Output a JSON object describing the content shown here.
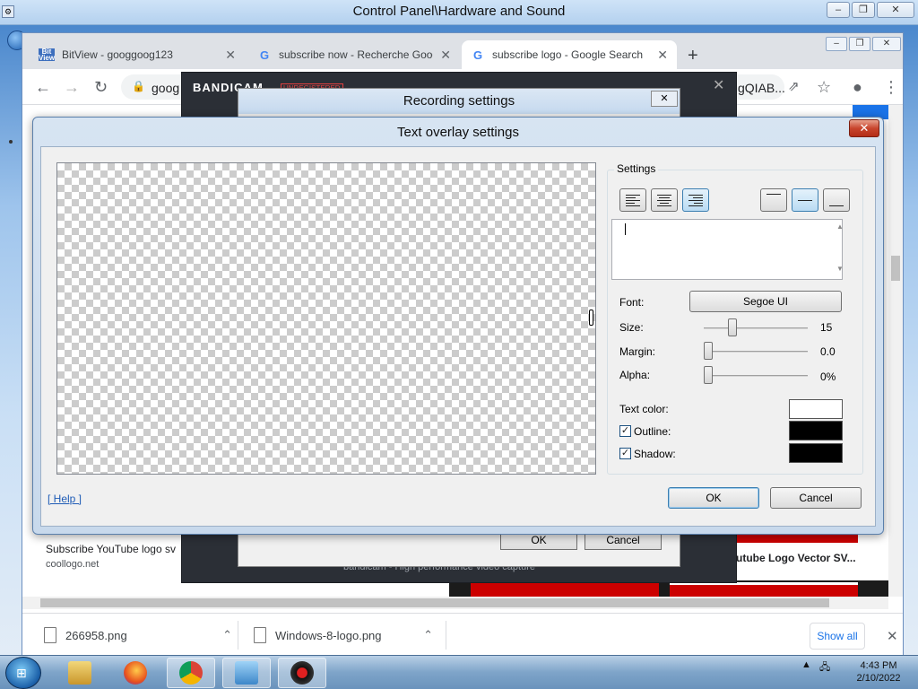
{
  "control_panel": {
    "title": "Control Panel\\Hardware and Sound"
  },
  "chrome": {
    "tabs": [
      {
        "label": "BitView - googgoog123"
      },
      {
        "label": "subscribe now - Recherche Goog"
      },
      {
        "label": "subscribe logo - Google Search"
      }
    ],
    "new_tab": "+",
    "address_text": "goog",
    "address_text_right": "gQIAB...",
    "page": {
      "caption_left": "Subscribe YouTube logo sv",
      "caption_left_source": "coollogo.net",
      "caption_right": "utube Logo Vector SV..."
    },
    "downloads": [
      {
        "name": "266958.png"
      },
      {
        "name": "Windows-8-logo.png"
      }
    ],
    "show_all": "Show all"
  },
  "bandicam": {
    "logo": "BANDICAM",
    "unregistered": "UNREGISTERED",
    "footer": "bandicam - High performance video capture"
  },
  "recording_settings": {
    "title": "Recording settings",
    "ok": "OK",
    "cancel": "Cancel"
  },
  "text_overlay": {
    "title": "Text overlay settings",
    "settings_label": "Settings",
    "text_value": "",
    "font_label": "Font:",
    "font_value": "Segoe UI",
    "size_label": "Size:",
    "size_value": "15",
    "size_level": 0.25,
    "margin_label": "Margin:",
    "margin_value": "0.0",
    "margin_level": 0,
    "alpha_label": "Alpha:",
    "alpha_value": "0%",
    "alpha_level": 0,
    "text_color_label": "Text color:",
    "text_color": "#ffffff",
    "outline_label": "Outline:",
    "outline_checked": true,
    "outline_color": "#000000",
    "shadow_label": "Shadow:",
    "shadow_checked": true,
    "shadow_color": "#000000",
    "help": "[ Help ]",
    "ok": "OK",
    "cancel": "Cancel",
    "horizontal_align_selected": "right",
    "vertical_align_selected": "middle"
  },
  "taskbar": {
    "apps": [
      "explorer-icon",
      "firefox-icon",
      "chrome-icon",
      "control-panel-icon",
      "bandicam-icon"
    ],
    "time": "4:43 PM",
    "date": "2/10/2022"
  }
}
